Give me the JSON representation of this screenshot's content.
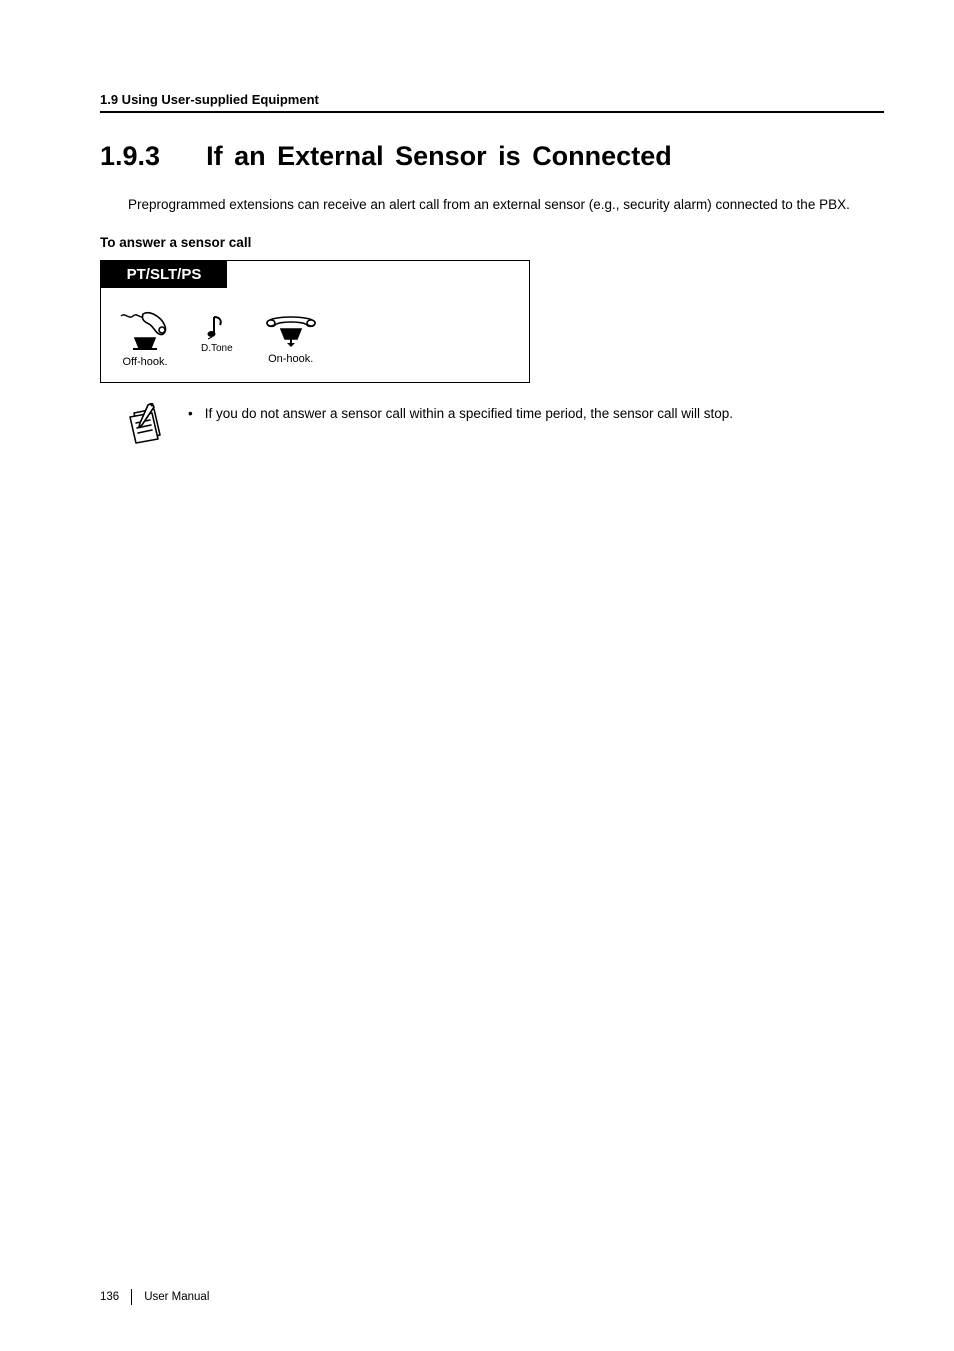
{
  "header": {
    "running_head": "1.9 Using User-supplied Equipment"
  },
  "section": {
    "number": "1.9.3",
    "title": "If an External Sensor is Connected",
    "intro": "Preprogrammed extensions can receive an alert call from an external sensor (e.g., security alarm) connected to the PBX."
  },
  "procedure": {
    "subhead": "To answer a sensor call",
    "device_label": "PT/SLT/PS",
    "steps": {
      "offhook": "Off-hook.",
      "tone": "D.Tone",
      "onhook": "On-hook."
    }
  },
  "note": {
    "bullet": "•",
    "text": "If you do not answer a sensor call within a specified time period, the sensor call will stop."
  },
  "footer": {
    "page_number": "136",
    "doc_label": "User Manual"
  }
}
